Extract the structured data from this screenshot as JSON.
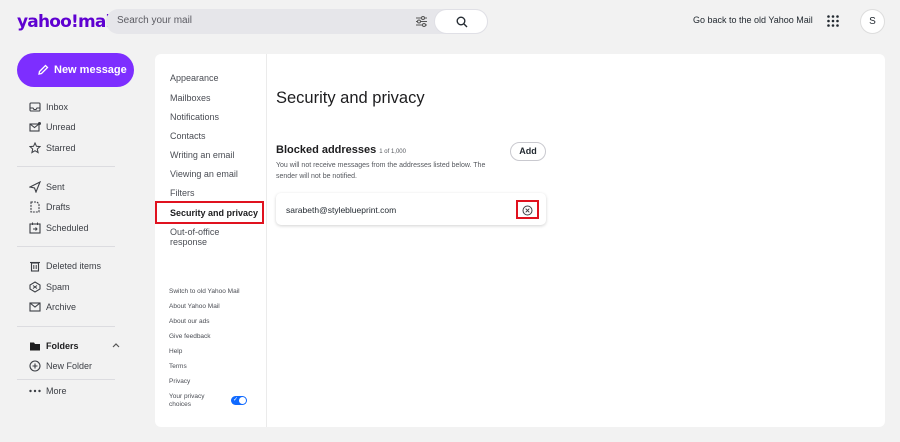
{
  "header": {
    "logo": "yahoo!mail",
    "search_placeholder": "Search your mail",
    "old_link": "Go back to the old Yahoo Mail",
    "avatar_initial": "S"
  },
  "sidebar": {
    "new_message": "New message",
    "items": [
      {
        "label": "Inbox",
        "icon": "inbox-icon"
      },
      {
        "label": "Unread",
        "icon": "unread-icon"
      },
      {
        "label": "Starred",
        "icon": "star-icon"
      },
      {
        "label": "Sent",
        "icon": "sent-icon"
      },
      {
        "label": "Drafts",
        "icon": "drafts-icon"
      },
      {
        "label": "Scheduled",
        "icon": "scheduled-icon"
      },
      {
        "label": "Deleted items",
        "icon": "trash-icon"
      },
      {
        "label": "Spam",
        "icon": "spam-icon"
      },
      {
        "label": "Archive",
        "icon": "archive-icon"
      },
      {
        "label": "Folders",
        "icon": "folder-icon"
      },
      {
        "label": "New Folder",
        "icon": "plus-circle-icon"
      },
      {
        "label": "More",
        "icon": "more-icon"
      }
    ]
  },
  "settings": {
    "items": [
      "Appearance",
      "Mailboxes",
      "Notifications",
      "Contacts",
      "Writing an email",
      "Viewing an email",
      "Filters",
      "Security and privacy",
      "Out-of-office",
      "response"
    ],
    "footer": [
      "Switch to old Yahoo Mail",
      "About Yahoo Mail",
      "About our ads",
      "Give feedback",
      "Help",
      "Terms",
      "Privacy",
      "Your privacy",
      "choices"
    ]
  },
  "main": {
    "title": "Security and privacy",
    "blocked_title": "Blocked addresses",
    "blocked_count": "1 of 1,000",
    "add_label": "Add",
    "desc_line1": "You will not receive messages from the addresses listed below. The",
    "desc_line2": "sender will not be notified.",
    "blocked": [
      "sarabeth@styleblueprint.com"
    ]
  },
  "colors": {
    "accent": "#7d2eff",
    "highlight": "#e0121f",
    "brand": "#5f01d1"
  }
}
